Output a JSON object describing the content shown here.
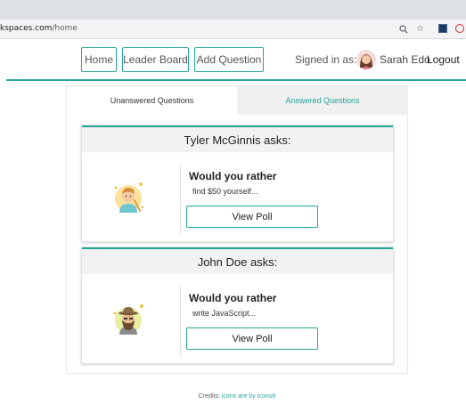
{
  "browser": {
    "url_prefix": "kspaces.com",
    "url_path": "/home",
    "icons": [
      "search-icon",
      "star-icon",
      "extension-icon",
      "profile-icon"
    ]
  },
  "nav": {
    "home": "Home",
    "leaderboard": "Leader Board",
    "add_question": "Add Question",
    "signed_in_as": "Signed in as:",
    "user_name": "Sarah Edo",
    "logout": "Logout"
  },
  "tabs": {
    "unanswered": "Unanswered Questions",
    "answered": "Answered Questions"
  },
  "questions": [
    {
      "author_heading": "Tyler McGinnis asks:",
      "title": "Would you rather",
      "teaser": "find $50 yourself...",
      "button": "View Poll",
      "avatar_icon": "boy-avatar-icon"
    },
    {
      "author_heading": "John Doe asks:",
      "title": "Would you rather",
      "teaser": "write JavaScript...",
      "button": "View Poll",
      "avatar_icon": "bearded-man-avatar-icon"
    }
  ],
  "credits": {
    "prefix": "Credits:",
    "link_text": "icons are by Icons8"
  },
  "colors": {
    "accent": "#26a69a",
    "tab_inactive_bg": "#f0f0f0",
    "card_header_bg": "#f2f2f2"
  }
}
